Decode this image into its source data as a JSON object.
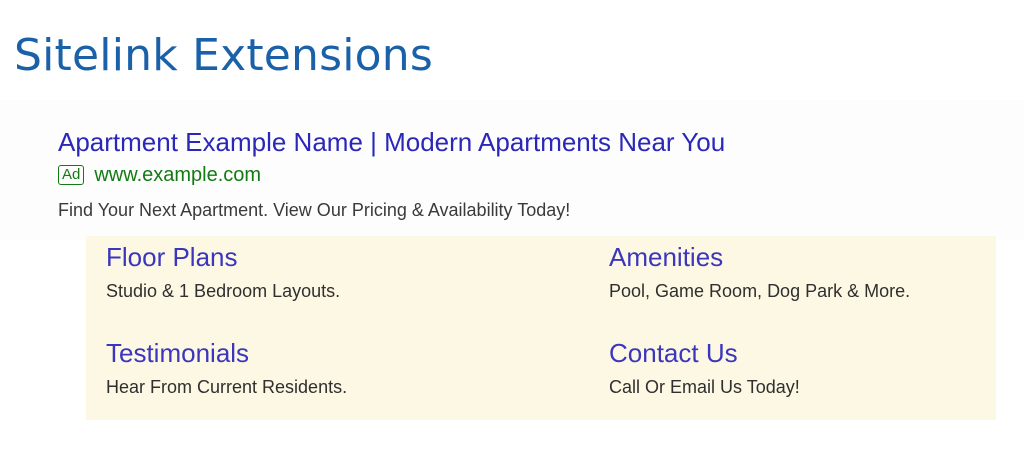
{
  "heading": "Sitelink Extensions",
  "ad": {
    "headline": "Apartment Example Name | Modern Apartments Near You",
    "badge": "Ad",
    "url": "www.example.com",
    "description": "Find Your Next Apartment. View Our Pricing & Availability Today!"
  },
  "sitelinks": [
    {
      "title": "Floor Plans",
      "description": "Studio & 1 Bedroom Layouts."
    },
    {
      "title": "Amenities",
      "description": "Pool, Game Room, Dog Park & More."
    },
    {
      "title": "Testimonials",
      "description": "Hear From Current Residents."
    },
    {
      "title": "Contact Us",
      "description": "Call Or Email Us Today!"
    }
  ],
  "colors": {
    "heading": "#1a61a8",
    "headline_link": "#2b27b8",
    "url_green": "#137a13",
    "sitelink_panel_bg": "#fdf8e3",
    "sitelink_link": "#3b36bd"
  }
}
